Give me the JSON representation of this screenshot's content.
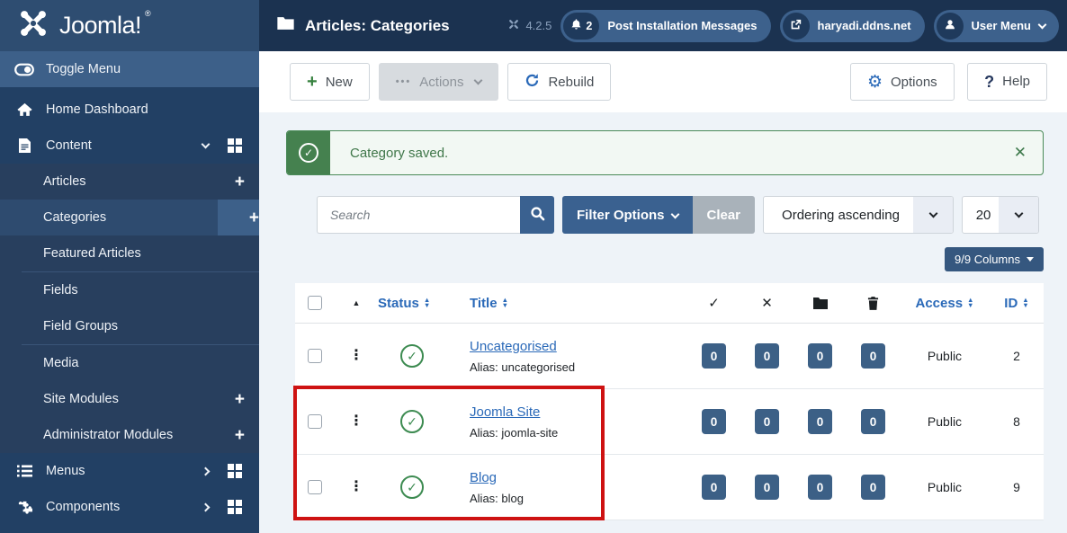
{
  "app": {
    "brand": "Joomla!",
    "brand_mark": "®",
    "page_title": "Articles: Categories",
    "version": "4.2.5"
  },
  "header": {
    "messages_count": "2",
    "messages_label": "Post Installation Messages",
    "site_link": "haryadi.ddns.net",
    "user_menu": "User Menu"
  },
  "sidebar": {
    "toggle": "Toggle Menu",
    "home": "Home Dashboard",
    "content": "Content",
    "articles": "Articles",
    "categories": "Categories",
    "featured_articles": "Featured Articles",
    "fields": "Fields",
    "field_groups": "Field Groups",
    "media": "Media",
    "site_modules": "Site Modules",
    "administrator_modules": "Administrator Modules",
    "menus": "Menus",
    "components": "Components"
  },
  "toolbar": {
    "new": "New",
    "actions": "Actions",
    "rebuild": "Rebuild",
    "options": "Options",
    "help": "Help"
  },
  "alert": {
    "message": "Category saved."
  },
  "filters": {
    "search_placeholder": "Search",
    "filter_options": "Filter Options",
    "clear": "Clear",
    "ordering": "Ordering ascending",
    "per_page": "20",
    "columns": "9/9 Columns"
  },
  "table": {
    "headers": {
      "status": "Status",
      "title": "Title",
      "access": "Access",
      "id": "ID"
    },
    "rows": [
      {
        "title": "Uncategorised",
        "alias": "Alias: uncategorised",
        "counts": [
          "0",
          "0",
          "0",
          "0"
        ],
        "access": "Public",
        "id": "2"
      },
      {
        "title": "Joomla Site",
        "alias": "Alias: joomla-site",
        "counts": [
          "0",
          "0",
          "0",
          "0"
        ],
        "access": "Public",
        "id": "8"
      },
      {
        "title": "Blog",
        "alias": "Alias: blog",
        "counts": [
          "0",
          "0",
          "0",
          "0"
        ],
        "access": "Public",
        "id": "9"
      }
    ]
  },
  "icons": {
    "check": "✓",
    "close": "✕",
    "sort_asc": "▲",
    "sort_desc": "▼",
    "caret_up": "▲",
    "ellipsis": "•••",
    "gear": "⚙",
    "question": "?",
    "dots": "⋮",
    "plus": "+"
  },
  "colors": {
    "header_navy": "#1b3250",
    "sidebar_navy": "#224064",
    "accent_blue": "#2a69b8",
    "button_blue": "#3a6190",
    "success_green": "#45814f",
    "annotation_red": "#ce1212"
  }
}
